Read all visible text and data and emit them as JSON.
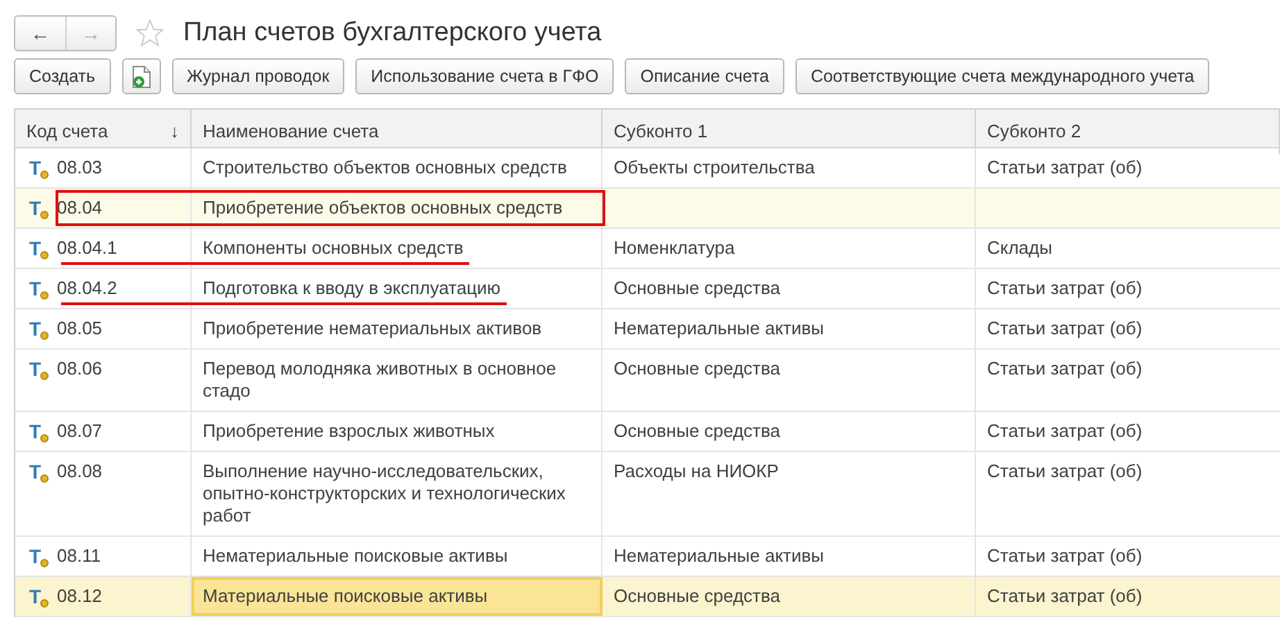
{
  "window": {
    "title": "План счетов бухгалтерского учета",
    "back": "←",
    "forward": "→",
    "favorite": false
  },
  "toolbar": {
    "buttons": [
      {
        "kind": "text",
        "label": "Создать"
      },
      {
        "kind": "icon"
      },
      {
        "kind": "text",
        "label": "Журнал проводок"
      },
      {
        "kind": "text",
        "label": "Использование счета в ГФО"
      },
      {
        "kind": "text",
        "label": "Описание счета"
      },
      {
        "kind": "text",
        "label": "Соответствующие счета международного учета"
      }
    ]
  },
  "table": {
    "columns": [
      {
        "label": "Код счета",
        "sort": "↓"
      },
      {
        "label": "Наименование счета"
      },
      {
        "label": "Субконто 1"
      },
      {
        "label": "Субконто 2"
      }
    ],
    "rows": [
      {
        "mark": "T",
        "code": "08.03",
        "name": "Строительство объектов основных средств",
        "sub1": "Объекты строительства",
        "sub2": "Статьи затрат (об)",
        "selected": false,
        "highlighted": false,
        "boxed": false,
        "underlined": false
      },
      {
        "mark": "T",
        "code": "08.04",
        "name": "Приобретение объектов основных средств",
        "selected": false,
        "highlighted": true,
        "boxed": true,
        "underlined": false
      },
      {
        "mark": "T",
        "code": "08.04.1",
        "name": "Компоненты основных средств",
        "sub1": "Номенклатура",
        "sub2": "Склады",
        "selected": false,
        "highlighted": false,
        "boxed": false,
        "underlined": true
      },
      {
        "mark": "T",
        "code": "08.04.2",
        "name": "Подготовка к вводу в эксплуатацию",
        "sub1": "Основные средства",
        "sub2": "Статьи затрат (об)",
        "selected": false,
        "highlighted": false,
        "boxed": false,
        "underlined": true
      },
      {
        "mark": "T",
        "code": "08.05",
        "name": "Приобретение нематериальных активов",
        "sub1": "Нематериальные активы",
        "sub2": "Статьи затрат (об)",
        "selected": false,
        "highlighted": false,
        "boxed": false,
        "underlined": false
      },
      {
        "mark": "T",
        "code": "08.06",
        "name": "Перевод молодняка животных в основное стадо",
        "sub1": "Основные средства",
        "sub2": "Статьи затрат (об)",
        "selected": false,
        "highlighted": false,
        "boxed": false,
        "underlined": false
      },
      {
        "mark": "T",
        "code": "08.07",
        "name": "Приобретение взрослых животных",
        "sub1": "Основные средства",
        "sub2": "Статьи затрат (об)",
        "selected": false,
        "highlighted": false,
        "boxed": false,
        "underlined": false
      },
      {
        "mark": "T",
        "code": "08.08",
        "name": "Выполнение научно-исследовательских, опытно-конструкторских и технологических работ",
        "sub1": "Расходы на НИОКР",
        "sub2": "Статьи затрат (об)",
        "selected": false,
        "highlighted": false,
        "boxed": false,
        "underlined": false
      },
      {
        "mark": "T",
        "code": "08.11",
        "name": "Нематериальные поисковые активы",
        "sub1": "Нематериальные активы",
        "sub2": "Статьи затрат (об)",
        "selected": false,
        "highlighted": false,
        "boxed": false,
        "underlined": false
      },
      {
        "mark": "T",
        "code": "08.12",
        "name": "Материальные поисковые активы",
        "sub1": "Основные средства",
        "sub2": "Статьи затрат (об)",
        "selected": true,
        "highlighted": false,
        "boxed": false,
        "underlined": false
      }
    ]
  }
}
